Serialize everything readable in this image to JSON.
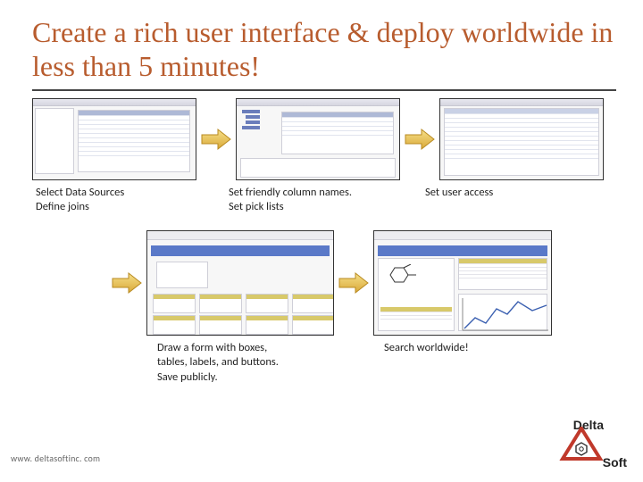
{
  "title": "Create a rich user interface & deploy worldwide in less than 5 minutes!",
  "captions": {
    "c1a": "Select Data Sources",
    "c1b": "Define joins",
    "c2a": "Set friendly column names.",
    "c2b": "Set pick lists",
    "c3": "Set user access",
    "c4a": "Draw a form with boxes,",
    "c4b": "tables, labels, and buttons.",
    "c4c": "Save publicly.",
    "c5": "Search worldwide!"
  },
  "logo": {
    "top": "Delta",
    "bottom": "Soft"
  },
  "footer_url": "www. deltasoftinc. com"
}
